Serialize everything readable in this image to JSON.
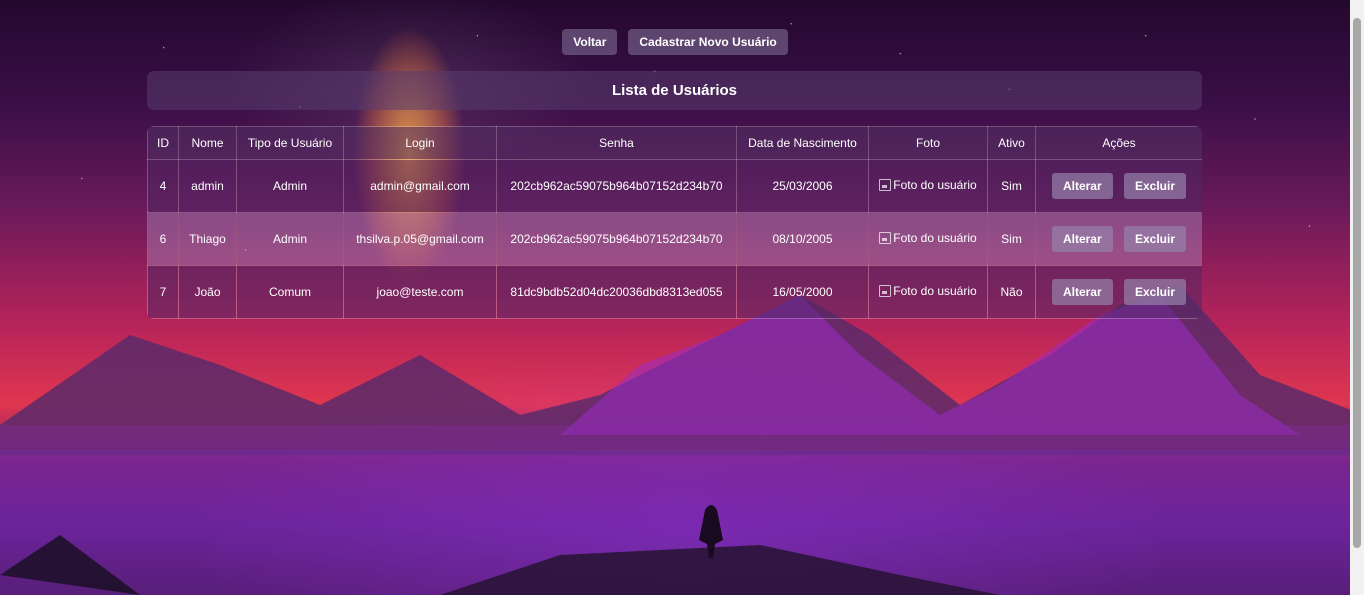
{
  "topbar": {
    "back_label": "Voltar",
    "new_user_label": "Cadastrar Novo Usuário"
  },
  "page_title": "Lista de Usuários",
  "table": {
    "headers": [
      "ID",
      "Nome",
      "Tipo de Usuário",
      "Login",
      "Senha",
      "Data de Nascimento",
      "Foto",
      "Ativo",
      "Ações"
    ],
    "rows": [
      {
        "id": "4",
        "nome": "admin",
        "tipo": "Admin",
        "login": "admin@gmail.com",
        "senha": "202cb962ac59075b964b07152d234b70",
        "nascimento": "25/03/2006",
        "foto_alt": "Foto do usuário",
        "ativo": "Sim"
      },
      {
        "id": "6",
        "nome": "Thiago",
        "tipo": "Admin",
        "login": "thsilva.p.05@gmail.com",
        "senha": "202cb962ac59075b964b07152d234b70",
        "nascimento": "08/10/2005",
        "foto_alt": "Foto do usuário",
        "ativo": "Sim"
      },
      {
        "id": "7",
        "nome": "João",
        "tipo": "Comum",
        "login": "joao@teste.com",
        "senha": "81dc9bdb52d04dc20036dbd8313ed055",
        "nascimento": "16/05/2000",
        "foto_alt": "Foto do usuário",
        "ativo": "Não"
      }
    ],
    "edit_label": "Alterar",
    "delete_label": "Excluir"
  },
  "colors": {
    "button_bg": "#7a6490",
    "text": "#ffffff"
  }
}
